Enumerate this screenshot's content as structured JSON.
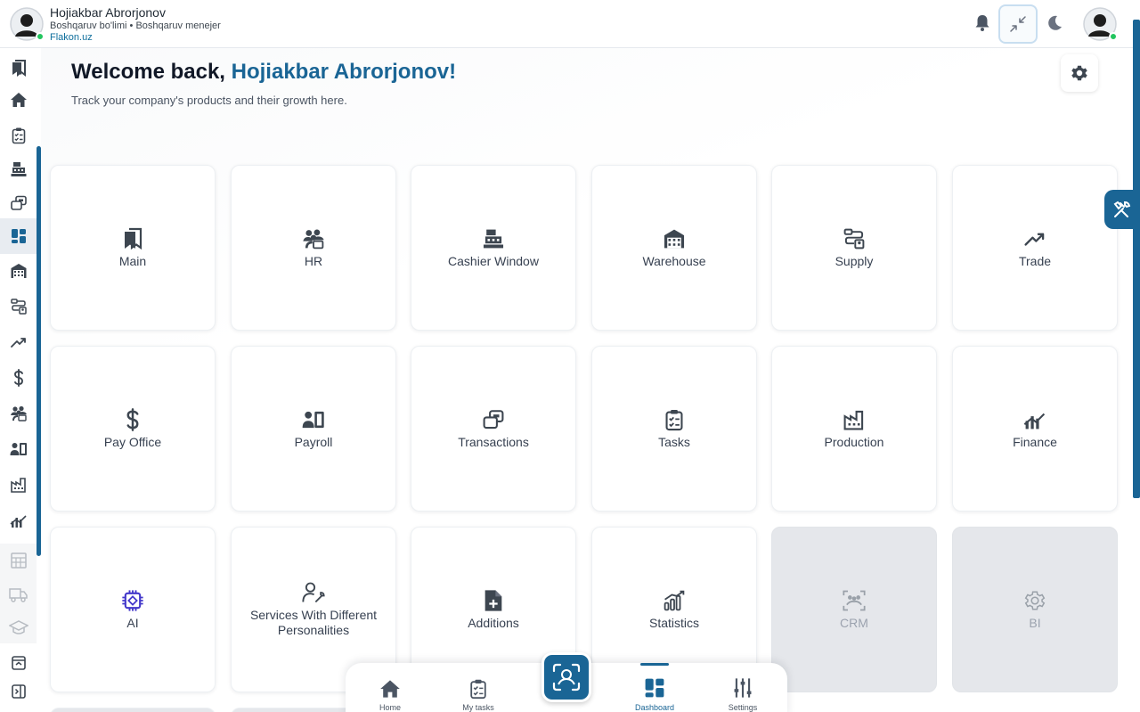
{
  "header": {
    "user_name": "Hojiakbar Abrorjonov",
    "user_dept": "Boshqaruv bo'limi • Boshqaruv menejer",
    "user_org": "Flakon.uz"
  },
  "welcome": {
    "prefix": "Welcome back, ",
    "name": "Hojiakbar Abrorjonov!",
    "subtitle": "Track your company's products and their growth here."
  },
  "cards": [
    {
      "label": "Main",
      "icon": "bookmark-icon",
      "enabled": true
    },
    {
      "label": "HR",
      "icon": "people-icon",
      "enabled": true
    },
    {
      "label": "Cashier Window",
      "icon": "cash-register-icon",
      "enabled": true
    },
    {
      "label": "Warehouse",
      "icon": "warehouse-icon",
      "enabled": true
    },
    {
      "label": "Supply",
      "icon": "supply-route-icon",
      "enabled": true
    },
    {
      "label": "Trade",
      "icon": "trend-up-icon",
      "enabled": true
    },
    {
      "label": "Pay Office",
      "icon": "dollar-icon",
      "enabled": true
    },
    {
      "label": "Payroll",
      "icon": "payroll-icon",
      "enabled": true
    },
    {
      "label": "Transactions",
      "icon": "transactions-icon",
      "enabled": true
    },
    {
      "label": "Tasks",
      "icon": "clipboard-icon",
      "enabled": true
    },
    {
      "label": "Production",
      "icon": "factory-icon",
      "enabled": true
    },
    {
      "label": "Finance",
      "icon": "finance-chart-icon",
      "enabled": true
    },
    {
      "label": "AI",
      "icon": "chip-icon",
      "enabled": true
    },
    {
      "label": "Services With Different Personalities",
      "icon": "person-wrench-icon",
      "enabled": true
    },
    {
      "label": "Additions",
      "icon": "file-plus-icon",
      "enabled": true
    },
    {
      "label": "Statistics",
      "icon": "statistics-icon",
      "enabled": true
    },
    {
      "label": "CRM",
      "icon": "crm-icon",
      "enabled": false
    },
    {
      "label": "BI",
      "icon": "bi-gear-icon",
      "enabled": false
    }
  ],
  "bottom_nav": [
    {
      "label": "Home",
      "icon": "home-icon",
      "active": false
    },
    {
      "label": "My tasks",
      "icon": "clipboard-icon",
      "active": false
    },
    {
      "label": "Dashboard",
      "icon": "dashboard-icon",
      "active": true
    },
    {
      "label": "Settings",
      "icon": "sliders-icon",
      "active": false
    }
  ],
  "sidebar_items": [
    {
      "icon": "bookmark-icon"
    },
    {
      "icon": "home-icon"
    },
    {
      "icon": "clipboard-icon"
    },
    {
      "icon": "cash-register-icon"
    },
    {
      "icon": "transactions-icon"
    },
    {
      "icon": "dashboard-icon",
      "active": true
    },
    {
      "icon": "warehouse-icon"
    },
    {
      "icon": "supply-route-icon"
    },
    {
      "icon": "trend-up-icon"
    },
    {
      "icon": "dollar-icon"
    },
    {
      "icon": "people-icon"
    },
    {
      "icon": "payroll-icon"
    },
    {
      "icon": "factory-icon"
    },
    {
      "icon": "finance-chart-icon"
    },
    {
      "icon": "calculator-icon",
      "disabled": true
    },
    {
      "icon": "truck-icon",
      "disabled": true
    },
    {
      "icon": "graduation-icon",
      "disabled": true
    }
  ],
  "colors": {
    "accent": "#1a6595",
    "text": "#1f2933",
    "icon": "#3d4650",
    "disabled_card": "#e5e7eb",
    "online": "#22c55e"
  }
}
